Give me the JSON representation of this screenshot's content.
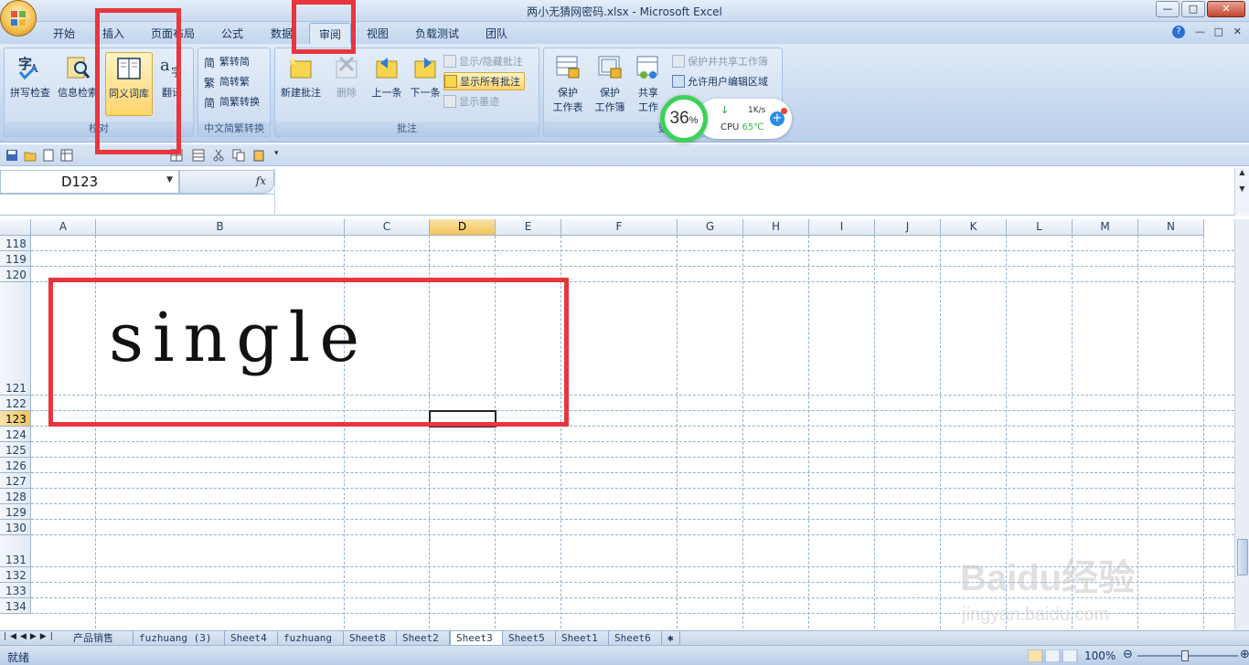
{
  "window": {
    "title": "两小无猜网密码.xlsx - Microsoft Excel",
    "min": "—",
    "max": "□",
    "close": "✕"
  },
  "tabs": [
    "开始",
    "插入",
    "页面布局",
    "公式",
    "数据",
    "审阅",
    "视图",
    "负载测试",
    "团队"
  ],
  "active_tab": "审阅",
  "ribbon": {
    "proofing": {
      "label": "校对",
      "spell": "拼写检查",
      "research": "信息检索",
      "thesaurus": "同义词库",
      "translate": "翻译"
    },
    "chinese": {
      "label": "中文简繁转换",
      "to_simplified": "繁转简",
      "to_traditional": "简转繁",
      "convert": "简繁转换"
    },
    "comments": {
      "label": "批注",
      "new": "新建批注",
      "delete": "删除",
      "prev": "上一条",
      "next": "下一条",
      "show_hide": "显示/隐藏批注",
      "show_all": "显示所有批注",
      "show_ink": "显示墨迹"
    },
    "changes": {
      "label": "更",
      "protect_sheet_1": "保护",
      "protect_sheet_2": "工作表",
      "protect_wb_1": "保护",
      "protect_wb_2": "工作簿",
      "share_1": "共享",
      "share_2": "工作",
      "protect_share": "保护并共享工作簿",
      "allow_edit": "允许用户编辑区域"
    }
  },
  "formula_bar": {
    "name_box": "D123",
    "fx": "fx",
    "formula": ""
  },
  "columns": [
    "A",
    "B",
    "C",
    "D",
    "E",
    "F",
    "G",
    "H",
    "I",
    "J",
    "K",
    "L",
    "M",
    "N"
  ],
  "selected_column": "D",
  "rows": [
    "118",
    "119",
    "120",
    "121",
    "122",
    "123",
    "124",
    "125",
    "126",
    "127",
    "128",
    "129",
    "130",
    "131",
    "132",
    "133",
    "134"
  ],
  "selected_row": "123",
  "cell_content": "single",
  "sheets": [
    "产品销售",
    "fuzhuang (3)",
    "Sheet4",
    "fuzhuang",
    "Sheet8",
    "Sheet2",
    "Sheet3",
    "Sheet5",
    "Sheet1",
    "Sheet6"
  ],
  "active_sheet": "Sheet3",
  "status": {
    "ready": "就绪",
    "zoom": "100%"
  },
  "cpu_widget": {
    "percent": "36",
    "percent_sign": "%",
    "speed": "1K/s",
    "label": "CPU",
    "temp": "65℃"
  },
  "watermark": {
    "brand": "Baidu经验",
    "url": "jingyan.baidu.com"
  },
  "colors": {
    "accent": "#e8353e",
    "ribbon": "#dfeaf7",
    "selection": "#f2c35a"
  }
}
